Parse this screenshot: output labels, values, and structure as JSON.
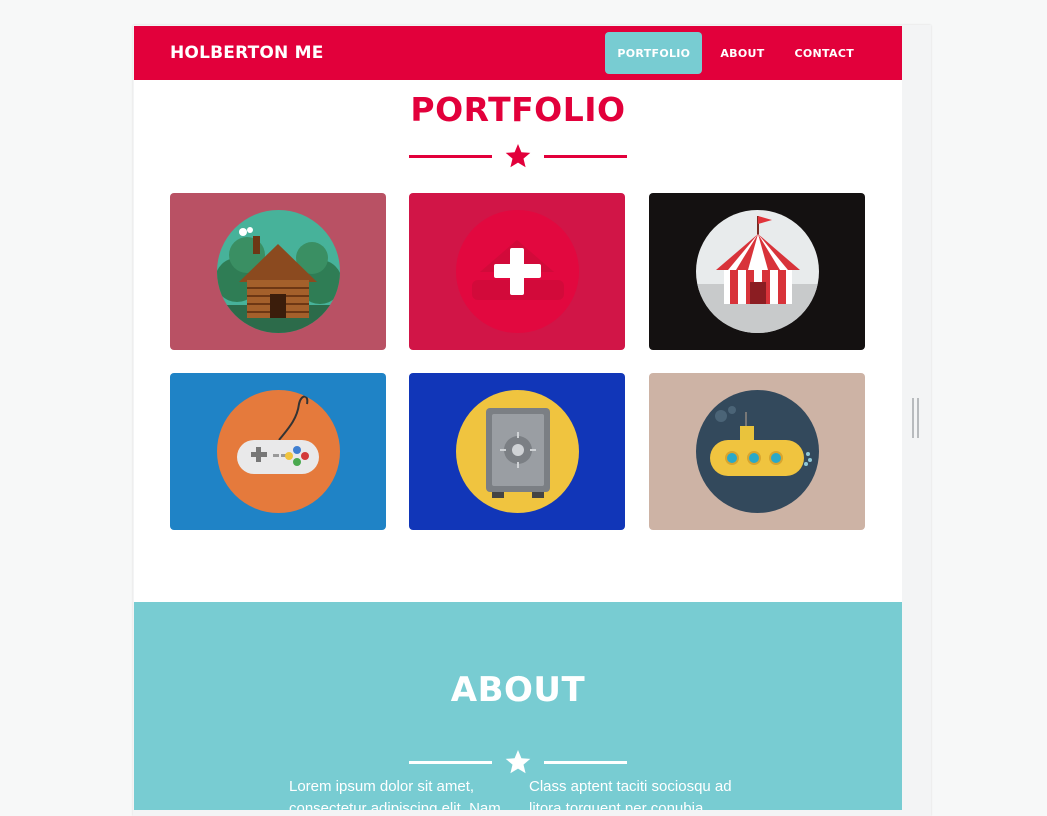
{
  "navbar": {
    "brand": "HOLBERTON ME",
    "links": [
      {
        "label": "PORTFOLIO",
        "active": true
      },
      {
        "label": "ABOUT",
        "active": false
      },
      {
        "label": "CONTACT",
        "active": false
      }
    ]
  },
  "portfolio": {
    "title": "PORTFOLIO",
    "accent_color": "#e2003b",
    "items": [
      {
        "icon": "cabin-icon",
        "bg": "#b95164",
        "circle": "#47b29a"
      },
      {
        "icon": "plus-icon",
        "bg": "#d11547",
        "circle": "#e2083f"
      },
      {
        "icon": "circus-tent-icon",
        "bg": "#141111",
        "circle": "#e8ebec"
      },
      {
        "icon": "gamepad-icon",
        "bg": "#1f83c6",
        "circle": "#e57a3c"
      },
      {
        "icon": "safe-icon",
        "bg": "#1136b8",
        "circle": "#f0c43f"
      },
      {
        "icon": "submarine-icon",
        "bg": "#cdb3a5",
        "circle": "#33495c"
      }
    ]
  },
  "about": {
    "title": "ABOUT",
    "bg": "#78ccd2",
    "col_left": "Lorem ipsum dolor sit amet, consectetur adipiscing elit. Nam",
    "col_right": "Class aptent taciti sociosqu ad litora torquent per conubia"
  }
}
